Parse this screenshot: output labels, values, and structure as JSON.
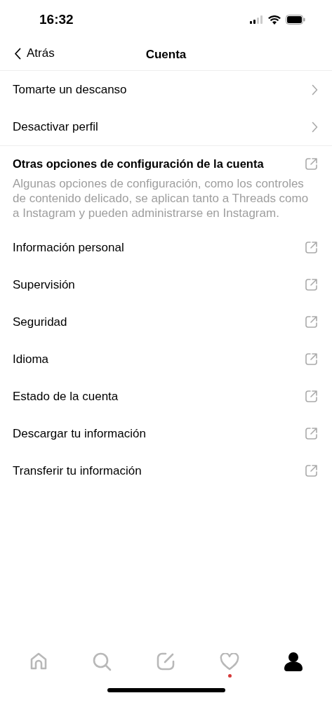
{
  "status_bar": {
    "time": "16:32"
  },
  "nav": {
    "back": "Atrás",
    "title": "Cuenta"
  },
  "top_rows": [
    {
      "label": "Tomarte un descanso",
      "kind": "chevron"
    },
    {
      "label": "Desactivar perfil",
      "kind": "chevron"
    }
  ],
  "section": {
    "title": "Otras opciones de configuración de la cuenta",
    "description": "Algunas opciones de configuración, como los controles de contenido delicado, se aplican tanto a Threads como a Instagram y pueden administrarse en Instagram."
  },
  "links": [
    {
      "label": "Información personal",
      "kind": "external"
    },
    {
      "label": "Supervisión",
      "kind": "external"
    },
    {
      "label": "Seguridad",
      "kind": "external"
    },
    {
      "label": "Idioma",
      "kind": "external"
    },
    {
      "label": "Estado de la cuenta",
      "kind": "external"
    },
    {
      "label": "Descargar tu información",
      "kind": "external"
    },
    {
      "label": "Transferir tu información",
      "kind": "external"
    }
  ],
  "tab_bar": [
    {
      "kind": "home",
      "selected": false,
      "notification": false
    },
    {
      "kind": "search",
      "selected": false,
      "notification": false
    },
    {
      "kind": "compose",
      "selected": false,
      "notification": false
    },
    {
      "kind": "activity",
      "selected": false,
      "notification": true
    },
    {
      "kind": "profile",
      "selected": true,
      "notification": false
    }
  ]
}
